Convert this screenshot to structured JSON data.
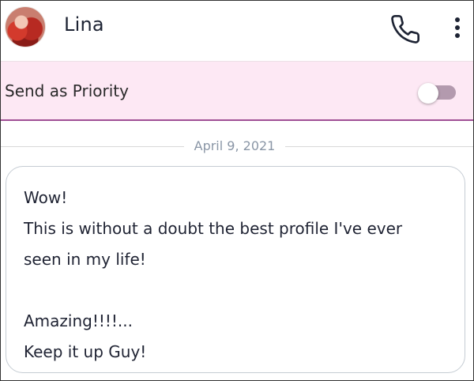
{
  "header": {
    "contact_name": "Lina",
    "avatar_icon": "avatar-photo",
    "call_icon": "phone-icon",
    "more_icon": "more-vertical-icon"
  },
  "priority": {
    "label": "Send as Priority",
    "enabled": false,
    "bar_color": "#fde8f4",
    "accent_color": "#a04f95"
  },
  "date_separator": {
    "text": "April 9, 2021"
  },
  "message": {
    "text": "Wow!\nThis is without a doubt the best profile I've ever\nseen in my life!\n\nAmazing!!!!...\nKeep it up Guy!"
  }
}
